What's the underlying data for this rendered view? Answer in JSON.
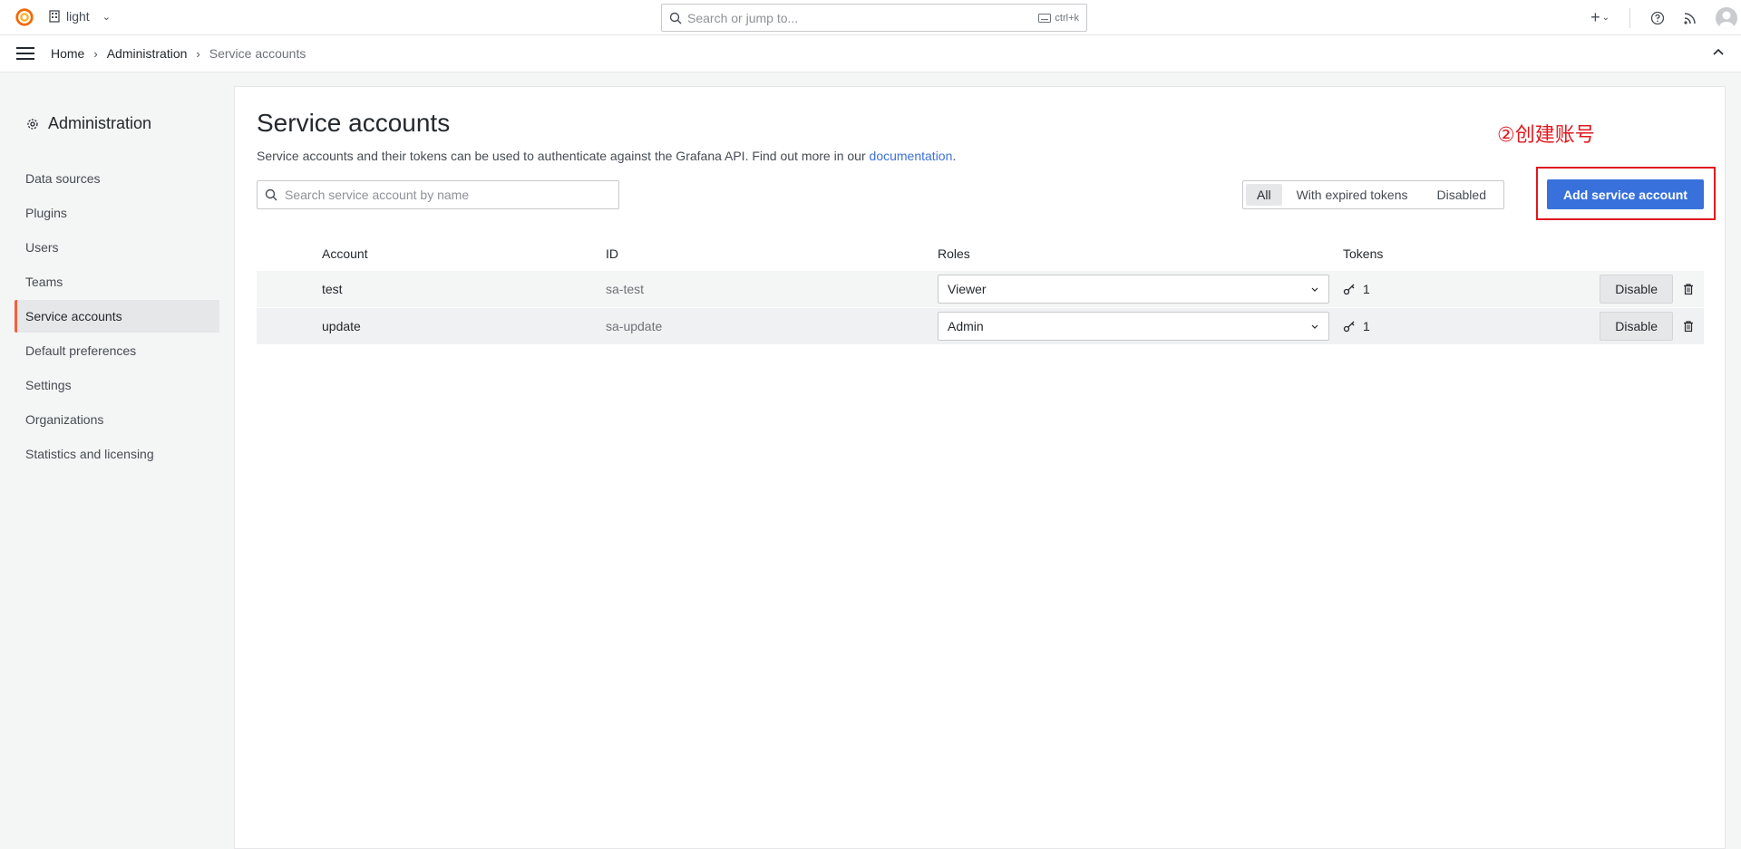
{
  "topbar": {
    "org_name": "light",
    "search_placeholder": "Search or jump to...",
    "search_shortcut": "ctrl+k"
  },
  "breadcrumb": {
    "items": [
      "Home",
      "Administration",
      "Service accounts"
    ]
  },
  "sidebar": {
    "title": "Administration",
    "items": [
      {
        "label": "Data sources"
      },
      {
        "label": "Plugins"
      },
      {
        "label": "Users"
      },
      {
        "label": "Teams"
      },
      {
        "label": "Service accounts",
        "active": true
      },
      {
        "label": "Default preferences"
      },
      {
        "label": "Settings"
      },
      {
        "label": "Organizations"
      },
      {
        "label": "Statistics and licensing"
      }
    ]
  },
  "main": {
    "title": "Service accounts",
    "description": "Service accounts and their tokens can be used to authenticate against the Grafana API. Find out more in our ",
    "doc_link": "documentation",
    "doc_suffix": ".",
    "annotation": "②创建账号",
    "search_placeholder": "Search service account by name",
    "filters": [
      "All",
      "With expired tokens",
      "Disabled"
    ],
    "selected_filter": "All",
    "add_button": "Add service account",
    "table": {
      "headers": [
        "Account",
        "ID",
        "Roles",
        "Tokens"
      ],
      "rows": [
        {
          "account": "test",
          "id": "sa-test",
          "role": "Viewer",
          "tokens": "1",
          "action": "Disable"
        },
        {
          "account": "update",
          "id": "sa-update",
          "role": "Admin",
          "tokens": "1",
          "action": "Disable"
        }
      ]
    }
  },
  "colors": {
    "accent": "#3871dc",
    "active_marker": "#f55f3e",
    "annotation": "#e0181e"
  },
  "icons": [
    "grafana-logo-icon",
    "building-icon",
    "search-icon",
    "keyboard-icon",
    "plus-icon",
    "help-icon",
    "rss-icon",
    "avatar-icon",
    "menu-icon",
    "chevron-up-icon",
    "gear-icon",
    "key-icon",
    "trash-icon",
    "chevron-down-icon"
  ]
}
